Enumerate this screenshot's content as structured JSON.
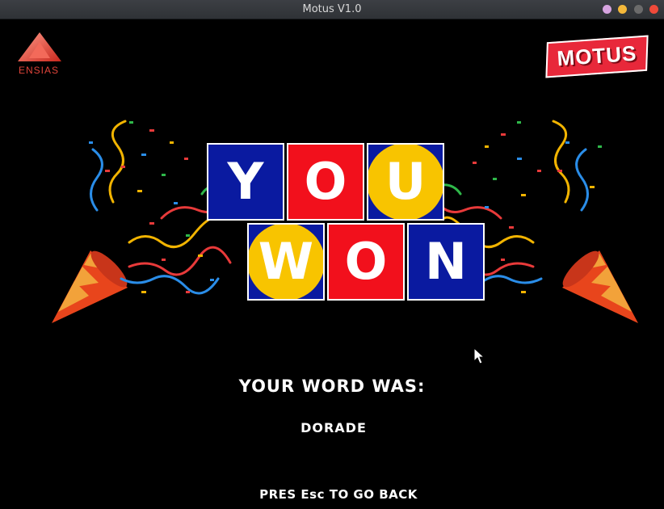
{
  "window": {
    "title": "Motus V1.0"
  },
  "logos": {
    "left": "ENSIAS",
    "right": "MOTUS"
  },
  "banner": {
    "row1": [
      {
        "letter": "Y",
        "tile": "blue",
        "disc": false
      },
      {
        "letter": "O",
        "tile": "red",
        "disc": false
      },
      {
        "letter": "U",
        "tile": "blue",
        "disc": true
      }
    ],
    "row2": [
      {
        "letter": "W",
        "tile": "blue",
        "disc": true
      },
      {
        "letter": "O",
        "tile": "red",
        "disc": false
      },
      {
        "letter": "N",
        "tile": "blue",
        "disc": false
      }
    ]
  },
  "result": {
    "label": "YOUR WORD WAS:",
    "word": "DORADE"
  },
  "hint": "PRES Esc TO GO BACK",
  "colors": {
    "tile_blue": "#0a1aa0",
    "tile_red": "#f2101c",
    "disc_yellow": "#f8c400",
    "logo_red": "#e8283a"
  },
  "icons": [
    "ensias-logo-icon",
    "motus-logo-icon",
    "party-popper-icon",
    "mouse-cursor-icon"
  ]
}
